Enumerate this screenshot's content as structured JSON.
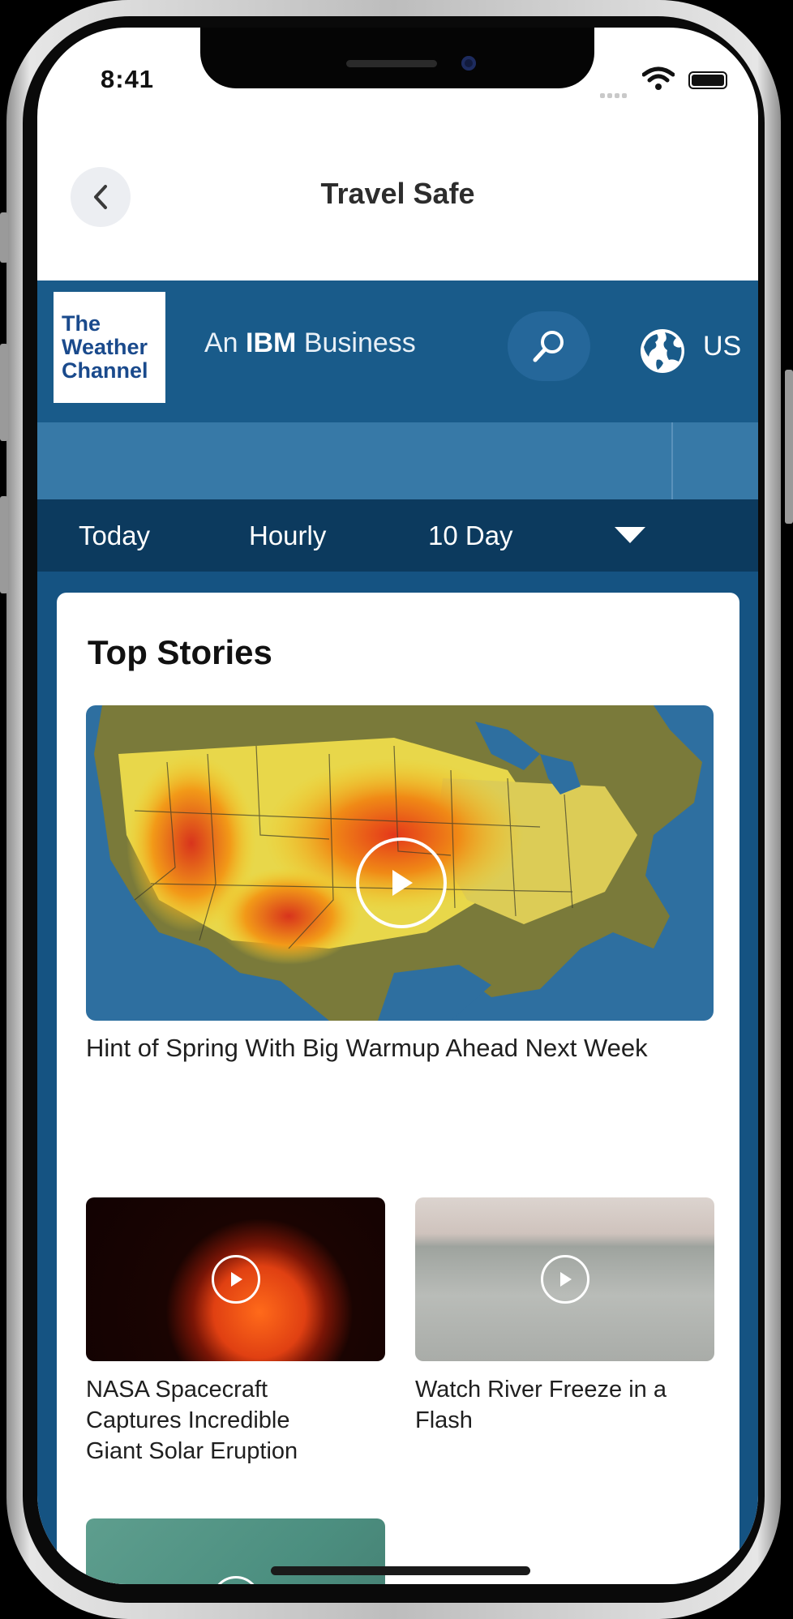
{
  "status_bar": {
    "time": "8:41"
  },
  "header": {
    "title": "Travel Safe"
  },
  "brand": {
    "logo_line1": "The",
    "logo_line2": "Weather",
    "logo_line3": "Channel",
    "tagline_prefix": "An",
    "tagline_strong": "IBM",
    "tagline_suffix": "Business",
    "locale": "US"
  },
  "tabs": [
    {
      "label": "Today"
    },
    {
      "label": "Hourly"
    },
    {
      "label": "10 Day"
    }
  ],
  "section": {
    "title": "Top Stories"
  },
  "stories": [
    {
      "title": "Hint of Spring With Big Warmup Ahead Next Week"
    },
    {
      "title": "NASA Spacecraft Captures Incredible Giant Solar Eruption"
    },
    {
      "title": "Watch River Freeze in a Flash"
    }
  ],
  "colors": {
    "brand_blue": "#195b8a",
    "sub_band": "#3779a7",
    "tab_bar": "#0c3a5e",
    "content_bg": "#155382"
  },
  "icons": [
    "back-icon",
    "search-icon",
    "globe-icon",
    "chevron-down-icon",
    "play-icon",
    "wifi-icon",
    "battery-icon"
  ]
}
